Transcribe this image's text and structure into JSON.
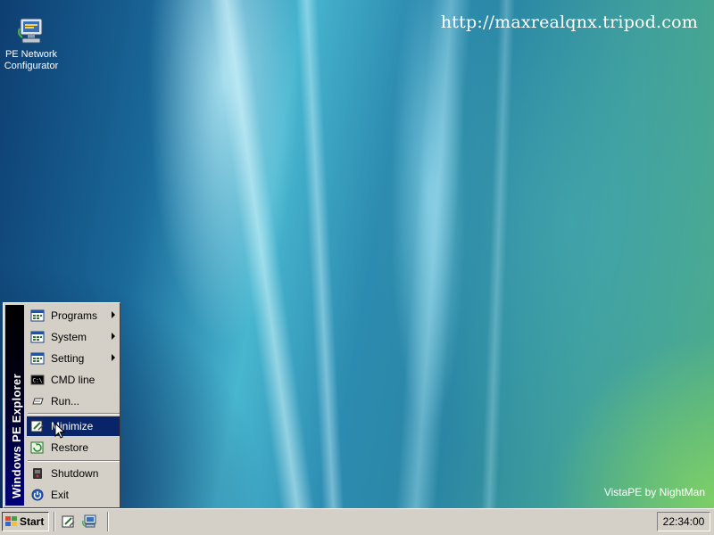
{
  "desktop": {
    "watermark_url": "http://maxrealqnx.tripod.com",
    "credit": "VistaPE by NightMan",
    "icons": [
      {
        "label_line1": "PE Network",
        "label_line2": "Configurator",
        "icon": "network-configurator-icon"
      }
    ]
  },
  "start_menu": {
    "banner": "Windows PE Explorer",
    "items": [
      {
        "label": "Programs",
        "icon": "folder-grid-icon",
        "submenu": true
      },
      {
        "label": "System",
        "icon": "folder-grid-icon",
        "submenu": true
      },
      {
        "label": "Setting",
        "icon": "folder-grid-icon",
        "submenu": true
      },
      {
        "label": "CMD line",
        "icon": "console-icon",
        "submenu": false
      },
      {
        "label": "Run...",
        "icon": "run-icon",
        "submenu": false
      },
      {
        "label": "Minimize",
        "icon": "minimize-icon",
        "highlighted": true
      },
      {
        "label": "Restore",
        "icon": "restore-icon"
      },
      {
        "label": "Shutdown",
        "icon": "shutdown-icon"
      },
      {
        "label": "Exit",
        "icon": "exit-icon"
      }
    ]
  },
  "taskbar": {
    "start_label": "Start",
    "quick_launch": [
      "minimize-all-icon",
      "network-config-icon"
    ],
    "clock": "22:34:00"
  },
  "colors": {
    "menu_highlight": "#0a246a",
    "menu_banner_bottom": "#00007a",
    "system_face": "#d4d0c8"
  }
}
